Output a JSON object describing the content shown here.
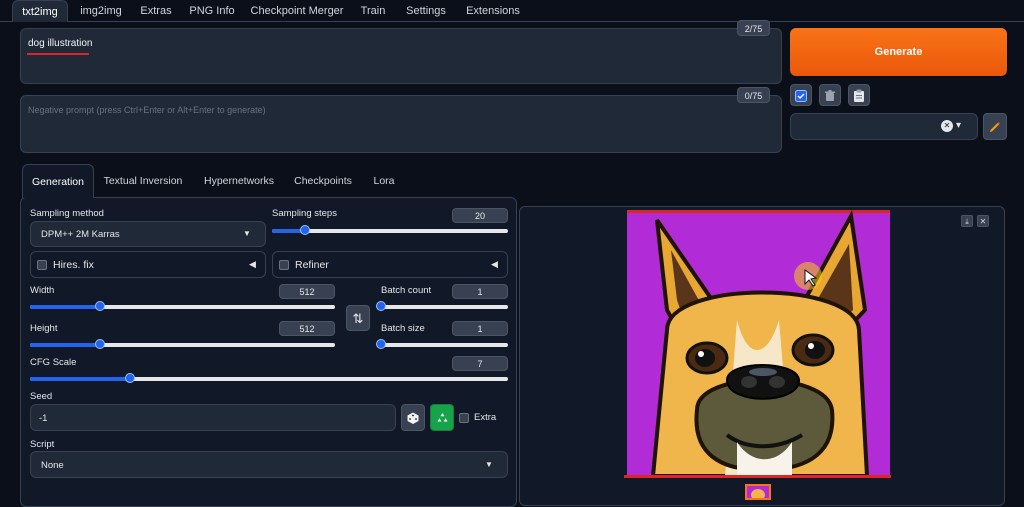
{
  "top_tabs": [
    "txt2img",
    "img2img",
    "Extras",
    "PNG Info",
    "Checkpoint Merger",
    "Train",
    "Settings",
    "Extensions"
  ],
  "prompt": {
    "value": "dog illustration",
    "token_count": "2/75"
  },
  "negative_prompt": {
    "placeholder": "Negative prompt (press Ctrl+Enter or Alt+Enter to generate)",
    "token_count": "0/75"
  },
  "generate_label": "Generate",
  "tool_icons": [
    "checkbox-icon",
    "trash-icon",
    "clipboard-icon"
  ],
  "styles": {
    "clear_icon": "✕",
    "dropdown_icon": "▾",
    "edit_icon": "pencil-icon"
  },
  "sub_tabs": [
    "Generation",
    "Textual Inversion",
    "Hypernetworks",
    "Checkpoints",
    "Lora"
  ],
  "sampling": {
    "method_label": "Sampling method",
    "method_value": "DPM++ 2M Karras",
    "steps_label": "Sampling steps",
    "steps_value": "20",
    "steps_fraction": 0.14
  },
  "hires": {
    "label": "Hires. fix"
  },
  "refiner": {
    "label": "Refiner"
  },
  "width": {
    "label": "Width",
    "value": "512",
    "fraction": 0.23
  },
  "height": {
    "label": "Height",
    "value": "512",
    "fraction": 0.23
  },
  "swap_icon": "⇅",
  "batch_count": {
    "label": "Batch count",
    "value": "1",
    "fraction": 0.0
  },
  "batch_size": {
    "label": "Batch size",
    "value": "1",
    "fraction": 0.0
  },
  "cfg": {
    "label": "CFG Scale",
    "value": "7",
    "fraction": 0.21
  },
  "seed": {
    "label": "Seed",
    "value": "-1",
    "extra_label": "Extra"
  },
  "script": {
    "label": "Script",
    "value": "None"
  },
  "colors": {
    "accent": "#2563eb",
    "generate": "#f97316",
    "image_bg": "#b12bd6",
    "red_line": "#dc2626"
  }
}
